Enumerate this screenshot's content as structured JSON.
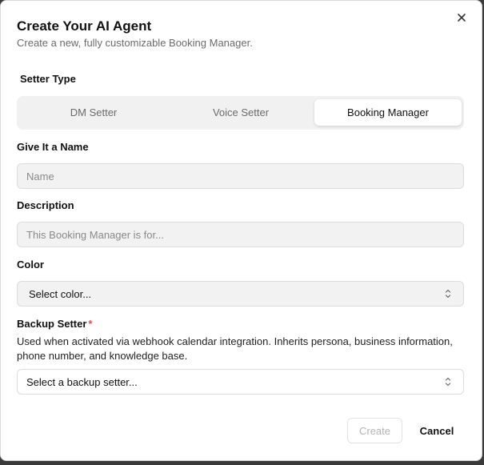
{
  "dialog": {
    "title": "Create Your AI Agent",
    "subtitle": "Create a new, fully customizable Booking Manager."
  },
  "setter_type": {
    "label": "Setter Type",
    "options": [
      {
        "label": "DM Setter",
        "active": false
      },
      {
        "label": "Voice Setter",
        "active": false
      },
      {
        "label": "Booking Manager",
        "active": true
      }
    ]
  },
  "name_field": {
    "label": "Give It a Name",
    "placeholder": "Name",
    "value": ""
  },
  "description_field": {
    "label": "Description",
    "placeholder": "This Booking Manager is for...",
    "value": ""
  },
  "color_field": {
    "label": "Color",
    "selected": "Select color..."
  },
  "backup_setter": {
    "label": "Backup Setter",
    "required_mark": "*",
    "help": "Used when activated via webhook calendar integration. Inherits persona, business information, phone number, and knowledge base.",
    "selected": "Select a backup setter..."
  },
  "actions": {
    "create_label": "Create",
    "cancel_label": "Cancel"
  },
  "colors": {
    "required": "#e5484d",
    "disabled_text": "#b4b4b4"
  }
}
